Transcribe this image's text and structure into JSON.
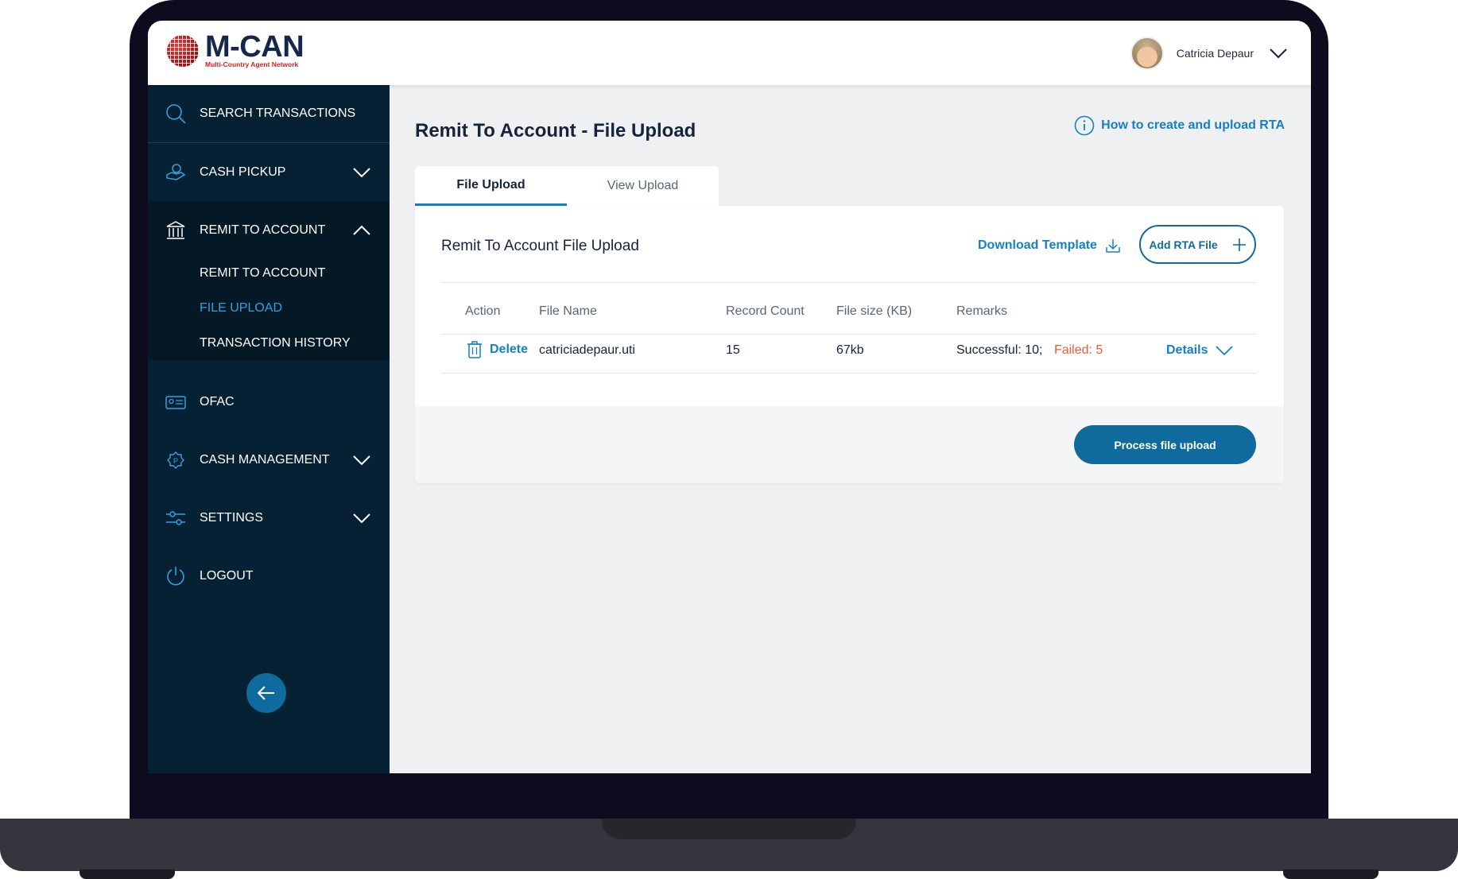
{
  "brand": {
    "name": "M-CAN",
    "tagline": "Multi-Country Agent Network"
  },
  "user": {
    "name": "Catricia Depaur"
  },
  "sidebar": {
    "items": [
      {
        "label": "SEARCH TRANSACTIONS",
        "icon": "search-icon"
      },
      {
        "label": "CASH PICKUP",
        "icon": "cash-pickup-icon",
        "expanded": false
      },
      {
        "label": "REMIT TO ACCOUNT",
        "icon": "bank-icon",
        "expanded": true,
        "children": [
          {
            "label": "REMIT TO ACCOUNT",
            "active": false
          },
          {
            "label": "FILE UPLOAD",
            "active": true
          },
          {
            "label": "TRANSACTION HISTORY",
            "active": false
          }
        ]
      },
      {
        "label": "OFAC",
        "icon": "id-card-icon"
      },
      {
        "label": "CASH MANAGEMENT",
        "icon": "cash-management-icon",
        "expanded": false
      },
      {
        "label": "SETTINGS",
        "icon": "settings-sliders-icon",
        "expanded": false
      },
      {
        "label": "LOGOUT",
        "icon": "power-icon"
      }
    ]
  },
  "page": {
    "title": "Remit To Account - File Upload",
    "help_link": "How to create and upload RTA",
    "tabs": [
      {
        "label": "File Upload",
        "active": true
      },
      {
        "label": "View Upload",
        "active": false
      }
    ]
  },
  "card": {
    "title": "Remit To Account File Upload",
    "download_template": "Download Template",
    "add_file": "Add RTA File",
    "columns": [
      "Action",
      "File Name",
      "Record Count",
      "File size (KB)",
      "Remarks"
    ],
    "rows": [
      {
        "action": "Delete",
        "file_name": "catriciadepaur.uti",
        "record_count": "15",
        "file_size": "67kb",
        "remarks_success": "Successful: 10;",
        "remarks_failed": "Failed: 5",
        "details": "Details"
      }
    ],
    "process_button": "Process file upload"
  },
  "colors": {
    "sidebar_bg": "#062134",
    "accent": "#1580c2",
    "primary_button": "#0f6a9e",
    "failed": "#ef5b36",
    "active_subitem": "#35a0df"
  }
}
